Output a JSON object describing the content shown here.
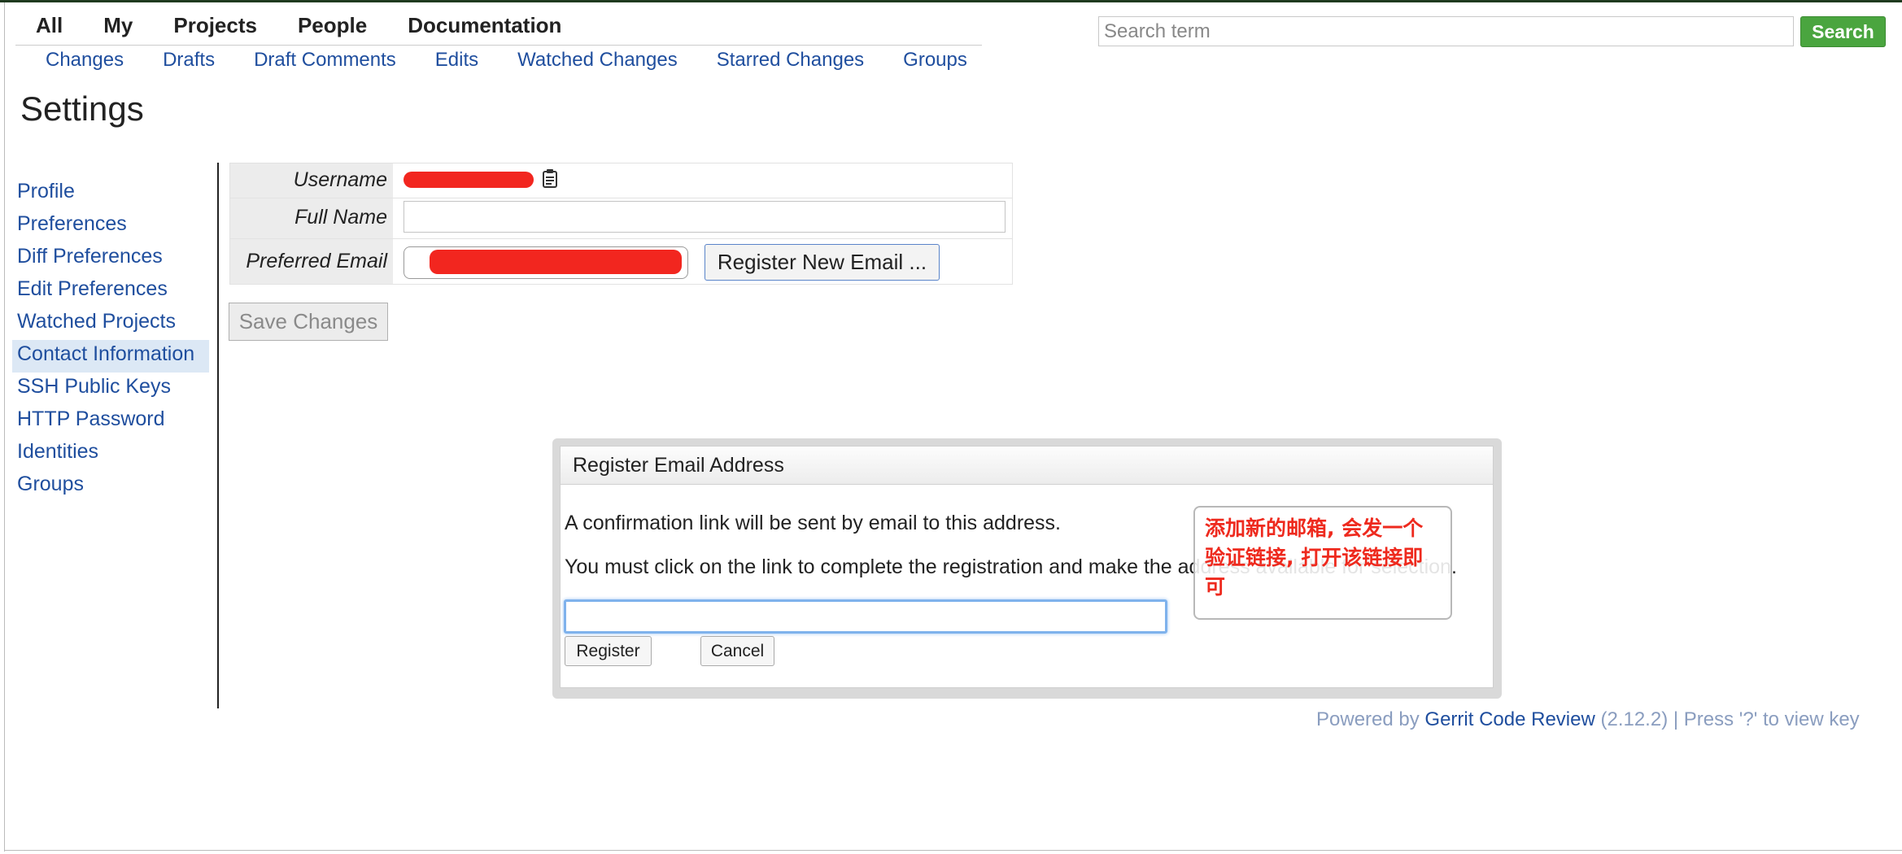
{
  "menu": {
    "items": [
      "All",
      "My",
      "Projects",
      "People",
      "Documentation"
    ]
  },
  "submenu": {
    "items": [
      "Changes",
      "Drafts",
      "Draft Comments",
      "Edits",
      "Watched Changes",
      "Starred Changes",
      "Groups"
    ]
  },
  "search": {
    "placeholder": "Search term",
    "button_label": "Search"
  },
  "page": {
    "title": "Settings"
  },
  "sidebar": {
    "items": [
      {
        "label": "Profile"
      },
      {
        "label": "Preferences"
      },
      {
        "label": "Diff Preferences"
      },
      {
        "label": "Edit Preferences"
      },
      {
        "label": "Watched Projects"
      },
      {
        "label": "Contact Information",
        "active": true
      },
      {
        "label": "SSH Public Keys"
      },
      {
        "label": "HTTP Password"
      },
      {
        "label": "Identities"
      },
      {
        "label": "Groups"
      }
    ]
  },
  "form": {
    "username_label": "Username",
    "fullname_label": "Full Name",
    "email_label": "Preferred Email",
    "register_new_email_label": "Register New Email ...",
    "save_changes_label": "Save Changes"
  },
  "dialog": {
    "title": "Register Email Address",
    "line1": "A confirmation link will be sent by email to this address.",
    "line2": "You must click on the link to complete the registration and make the address available for selection.",
    "register_label": "Register",
    "cancel_label": "Cancel"
  },
  "annotation": {
    "text": "添加新的邮箱, 会发一个验证链接, 打开该链接即可"
  },
  "footer": {
    "prefix": "Powered by ",
    "link": "Gerrit Code Review",
    "suffix": " (2.12.2) | Press '?' to view key"
  },
  "colors": {
    "link": "#1f4e9e",
    "search_button": "#4aa53f",
    "annotation_text": "#ee2a1e",
    "redaction": "#f2261f"
  },
  "icons": {
    "copy": "clipboard-icon"
  }
}
